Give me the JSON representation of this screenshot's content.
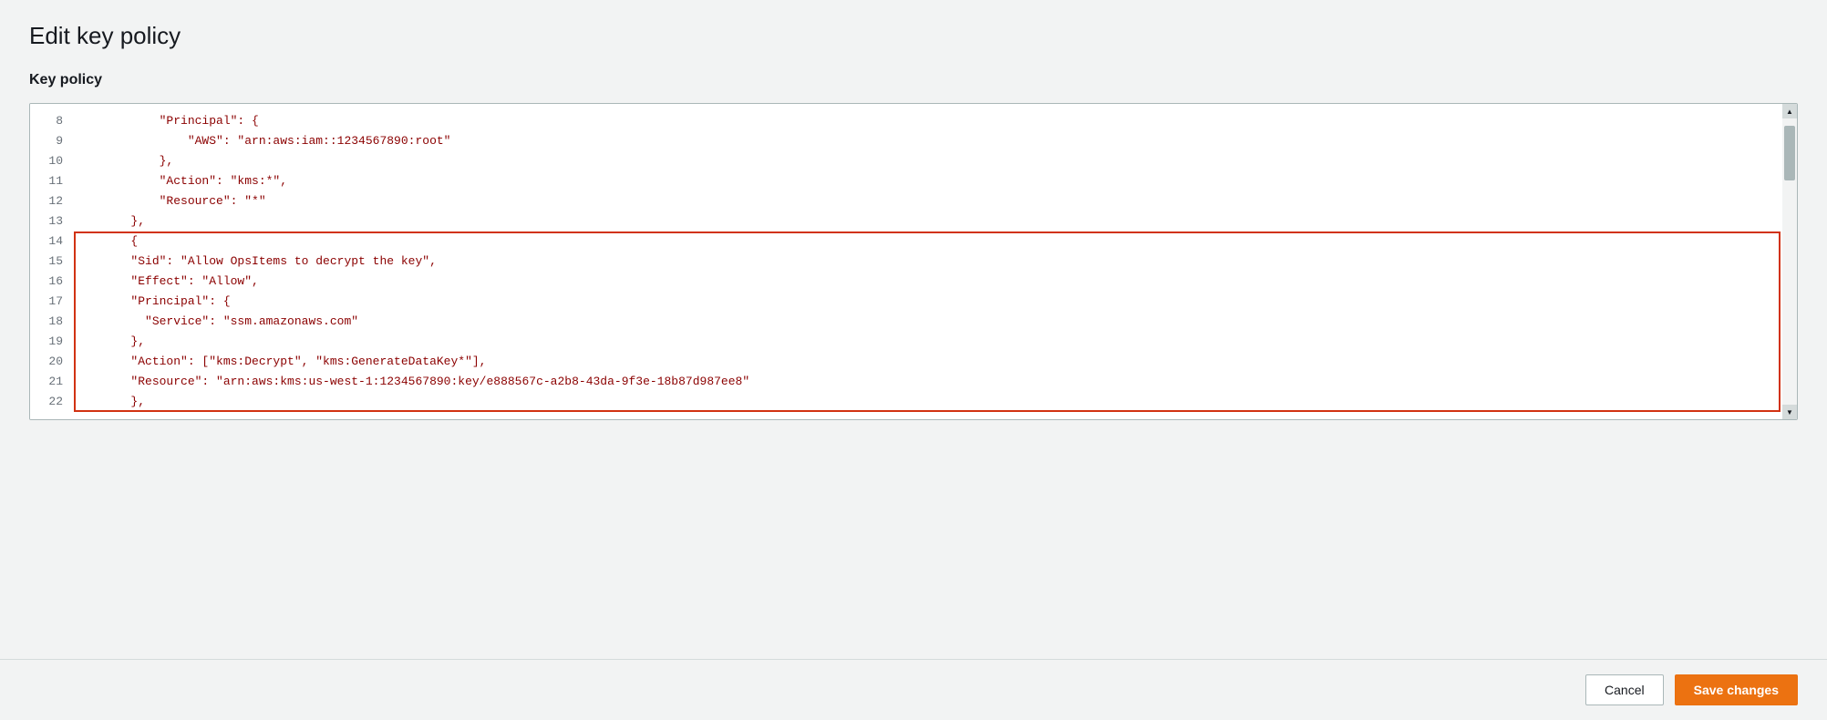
{
  "page": {
    "title": "Edit key policy",
    "section_label": "Key policy"
  },
  "footer": {
    "cancel_label": "Cancel",
    "save_label": "Save changes"
  },
  "editor": {
    "lines": [
      {
        "number": 8,
        "content": "            \"Principal\": {"
      },
      {
        "number": 9,
        "content": "                \"AWS\": \"arn:aws:iam::1234567890:root\""
      },
      {
        "number": 10,
        "content": "            },"
      },
      {
        "number": 11,
        "content": "            \"Action\": \"kms:*\","
      },
      {
        "number": 12,
        "content": "            \"Resource\": \"*\""
      },
      {
        "number": 13,
        "content": "        },"
      },
      {
        "number": 14,
        "content": "        {"
      },
      {
        "number": 15,
        "content": "        \"Sid\": \"Allow OpsItems to decrypt the key\","
      },
      {
        "number": 16,
        "content": "        \"Effect\": \"Allow\","
      },
      {
        "number": 17,
        "content": "        \"Principal\": {"
      },
      {
        "number": 18,
        "content": "          \"Service\": \"ssm.amazonaws.com\""
      },
      {
        "number": 19,
        "content": "        },"
      },
      {
        "number": 20,
        "content": "        \"Action\": [\"kms:Decrypt\", \"kms:GenerateDataKey*\"],"
      },
      {
        "number": 21,
        "content": "        \"Resource\": \"arn:aws:kms:us-west-1:1234567890:key/e888567c-a2b8-43da-9f3e-18b87d987ee8\""
      },
      {
        "number": 22,
        "content": "        },"
      }
    ],
    "highlight_start_line": 14,
    "highlight_end_line": 22
  }
}
